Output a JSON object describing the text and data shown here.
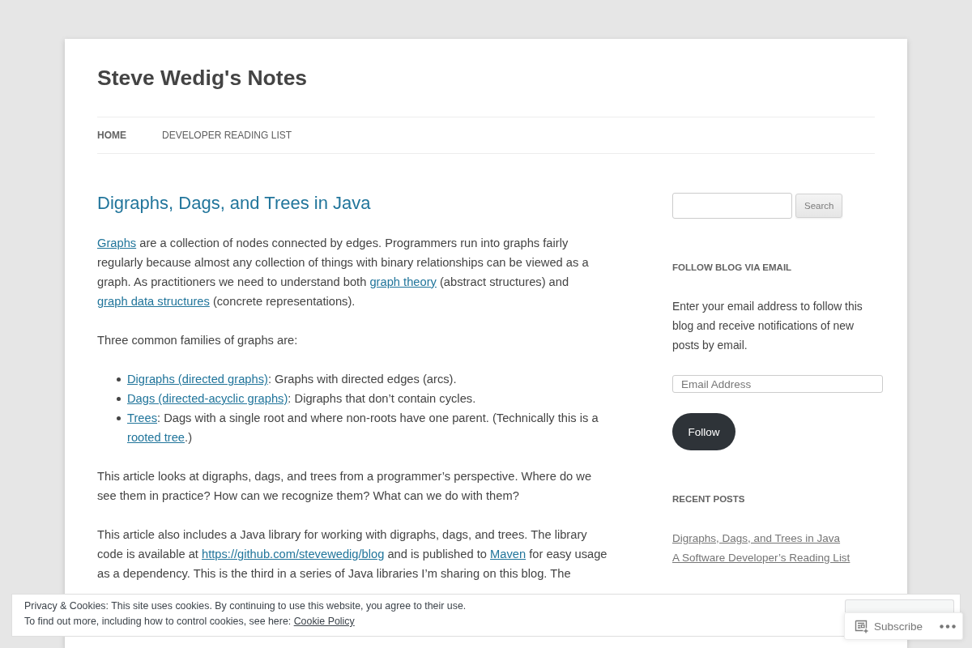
{
  "site": {
    "title": "Steve Wedig's Notes"
  },
  "nav": [
    {
      "label": "HOME",
      "selected": true
    },
    {
      "label": "DEVELOPER READING LIST",
      "selected": false
    }
  ],
  "article": {
    "title": "Digraphs, Dags, and Trees in Java",
    "blocks": [
      {
        "kind": "paragraph",
        "parts": [
          {
            "kind": "link",
            "text": "Graphs"
          },
          {
            "kind": "text",
            "text": " are a collection of nodes connected by edges. Programmers run into graphs fairly regularly because almost any collection of things with binary relationships can be viewed as a graph. As practitioners we need to understand both "
          },
          {
            "kind": "link",
            "text": "graph theory"
          },
          {
            "kind": "text",
            "text": " (abstract structures) and "
          },
          {
            "kind": "link",
            "text": "graph data structures"
          },
          {
            "kind": "text",
            "text": " (concrete representations)."
          }
        ]
      },
      {
        "kind": "paragraph",
        "parts": [
          {
            "kind": "text",
            "text": "Three common families of graphs are:"
          }
        ]
      },
      {
        "kind": "list",
        "items": [
          {
            "parts": [
              {
                "kind": "link",
                "text": "Digraphs (directed graphs)"
              },
              {
                "kind": "text",
                "text": ": Graphs with directed edges (arcs)."
              }
            ]
          },
          {
            "parts": [
              {
                "kind": "link",
                "text": "Dags (directed-acyclic graphs)"
              },
              {
                "kind": "text",
                "text": ": Digraphs that don’t contain cycles."
              }
            ]
          },
          {
            "parts": [
              {
                "kind": "link",
                "text": "Trees"
              },
              {
                "kind": "text",
                "text": ": Dags with a single root and where non-roots have one parent. (Technically this is a "
              },
              {
                "kind": "link",
                "text": "rooted tree"
              },
              {
                "kind": "text",
                "text": ".)"
              }
            ]
          }
        ]
      },
      {
        "kind": "paragraph",
        "parts": [
          {
            "kind": "text",
            "text": "This article looks at digraphs, dags, and trees from a programmer’s perspective. Where do we see them in practice? How can we recognize them? What can we do with them?"
          }
        ]
      },
      {
        "kind": "paragraph",
        "parts": [
          {
            "kind": "text",
            "text": "This article also includes a Java library for working with digraphs, dags, and trees. The library code is available at "
          },
          {
            "kind": "link",
            "text": "https://github.com/stevewedig/blog"
          },
          {
            "kind": "text",
            "text": " and is published to "
          },
          {
            "kind": "link",
            "text": "Maven"
          },
          {
            "kind": "text",
            "text": " for easy usage as a dependency. This is the third in a series of Java libraries I’m sharing on this blog. The"
          }
        ]
      }
    ]
  },
  "sidebar": {
    "search": {
      "button": "Search"
    },
    "follow": {
      "heading": "FOLLOW BLOG VIA EMAIL",
      "text": "Enter your email address to follow this blog and receive notifications of new posts by email.",
      "placeholder": "Email Address",
      "button": "Follow"
    },
    "recent": {
      "heading": "RECENT POSTS",
      "posts": [
        "Digraphs, Dags, and Trees in Java",
        "A Software Developer’s Reading List"
      ]
    }
  },
  "cookie_notice": {
    "lines": [
      {
        "parts": [
          {
            "kind": "text",
            "text": "Privacy & Cookies: This site uses cookies. By continuing to use this website, you agree to their use."
          }
        ]
      },
      {
        "parts": [
          {
            "kind": "text",
            "text": "To find out more, including how to control cookies, see here: "
          },
          {
            "kind": "link",
            "text": "Cookie Policy"
          }
        ]
      }
    ]
  },
  "subscribe_bar": {
    "label": "Subscribe"
  }
}
